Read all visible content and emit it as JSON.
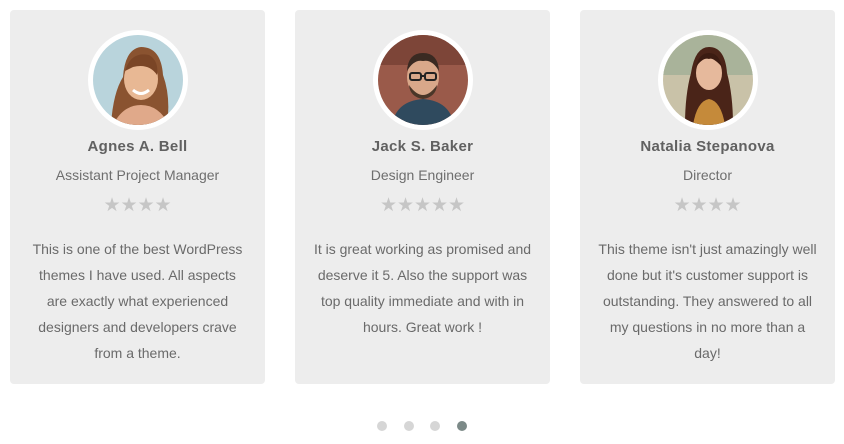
{
  "testimonials": [
    {
      "name": "Agnes A. Bell",
      "role": "Assistant Project Manager",
      "rating": 4,
      "rating_max": 4,
      "text": "This is one of the best WordPress themes I have used. All aspects are exactly what experienced designers and developers crave from a theme."
    },
    {
      "name": "Jack S. Baker",
      "role": "Design Engineer",
      "rating": 5,
      "rating_max": 5,
      "text": "It is great working as promised and deserve it 5. Also the support was top quality immediate and with in hours. Great work !"
    },
    {
      "name": "Natalia Stepanova",
      "role": "Director",
      "rating": 4,
      "rating_max": 4,
      "text": "This theme isn't just amazingly well done but it's customer support is outstanding. They answered to all my questions in no more than a day!"
    }
  ],
  "pagination": {
    "count": 4,
    "active_index": 3
  },
  "colors": {
    "card_bg": "#ededed",
    "star": "#c6c6c6",
    "dot": "#d6d6d6",
    "dot_active": "#7c8a88"
  }
}
